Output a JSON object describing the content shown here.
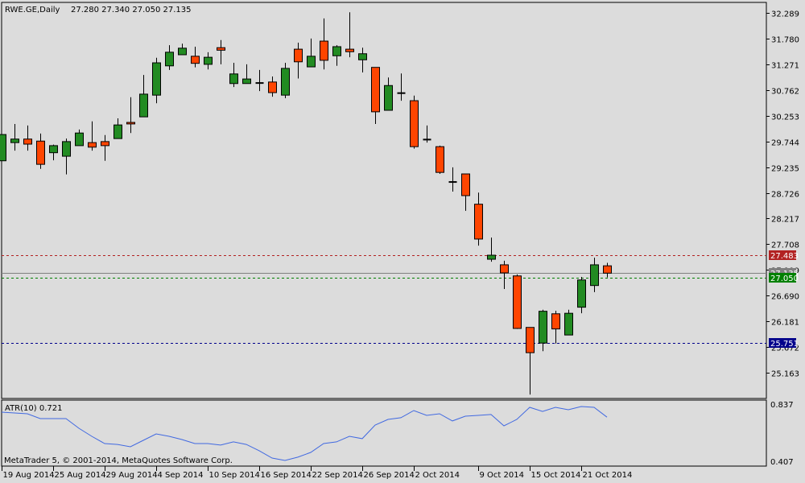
{
  "header": {
    "symbol_info": "RWE.GE,Daily",
    "ohlc": "27.280 27.340 27.050 27.135"
  },
  "indicator": {
    "label": "ATR(10) 0.721",
    "axis_top": "0.837",
    "axis_bottom": "0.407"
  },
  "copyright": "MetaTrader 5, © 2001-2014, MetaQuotes Software Corp.",
  "colors": {
    "background": "#dcdcdc",
    "bull": "#228b22",
    "bear": "#ff4500",
    "atr_line": "#4169e1",
    "ask_line": "#b22222",
    "bid_line": "#008000",
    "level_line": "#00008b",
    "last_line": "#808080"
  },
  "price_levels": [
    {
      "name": "ask-line",
      "value": "27.483",
      "color": "#b22222",
      "style": "dashed"
    },
    {
      "name": "last-price-line",
      "value": "27.135",
      "color": "#808080",
      "style": "solid"
    },
    {
      "name": "bid-line",
      "value": "27.050",
      "color": "#008000",
      "style": "dashed"
    },
    {
      "name": "horizontal-level-line",
      "value": "25.751",
      "color": "#00008b",
      "style": "dashed"
    }
  ],
  "chart_data": {
    "type": "candlestick",
    "price_axis_ticks": [
      "32.289",
      "31.780",
      "31.271",
      "30.762",
      "30.253",
      "29.744",
      "29.235",
      "28.726",
      "28.217",
      "27.708",
      "27.199",
      "26.690",
      "26.181",
      "25.672",
      "25.163"
    ],
    "date_labels": [
      {
        "index": 0,
        "label": "19 Aug 2014"
      },
      {
        "index": 4,
        "label": "25 Aug 2014"
      },
      {
        "index": 8,
        "label": "29 Aug 2014"
      },
      {
        "index": 12,
        "label": "4 Sep 2014"
      },
      {
        "index": 16,
        "label": "10 Sep 2014"
      },
      {
        "index": 20,
        "label": "16 Sep 2014"
      },
      {
        "index": 24,
        "label": "22 Sep 2014"
      },
      {
        "index": 28,
        "label": "26 Sep 2014"
      },
      {
        "index": 32,
        "label": "2 Oct 2014"
      },
      {
        "index": 37,
        "label": "9 Oct 2014"
      },
      {
        "index": 41,
        "label": "15 Oct 2014"
      },
      {
        "index": 45,
        "label": "21 Oct 2014"
      }
    ],
    "ohlc": [
      [
        29.36,
        29.88,
        29.36,
        29.88
      ],
      [
        29.72,
        30.09,
        29.56,
        29.79
      ],
      [
        29.79,
        30.06,
        29.56,
        29.69
      ],
      [
        29.75,
        29.9,
        29.2,
        29.29
      ],
      [
        29.52,
        29.68,
        29.37,
        29.66
      ],
      [
        29.45,
        29.8,
        29.09,
        29.74
      ],
      [
        29.66,
        29.98,
        29.66,
        29.91
      ],
      [
        29.72,
        30.14,
        29.56,
        29.63
      ],
      [
        29.74,
        29.87,
        29.36,
        29.66
      ],
      [
        29.8,
        30.2,
        29.8,
        30.07
      ],
      [
        30.12,
        30.62,
        29.91,
        30.09
      ],
      [
        30.23,
        31.06,
        30.23,
        30.68
      ],
      [
        30.66,
        31.4,
        30.5,
        31.3
      ],
      [
        31.24,
        31.65,
        31.16,
        31.51
      ],
      [
        31.46,
        31.68,
        31.46,
        31.59
      ],
      [
        31.43,
        31.62,
        31.21,
        31.29
      ],
      [
        31.27,
        31.51,
        31.17,
        31.41
      ],
      [
        31.6,
        31.75,
        31.27,
        31.55
      ],
      [
        30.89,
        31.3,
        30.82,
        31.08
      ],
      [
        30.89,
        31.27,
        30.89,
        30.98
      ],
      [
        30.9,
        31.16,
        30.74,
        30.9
      ],
      [
        30.92,
        31.03,
        30.63,
        30.71
      ],
      [
        30.66,
        31.3,
        30.6,
        31.19
      ],
      [
        31.57,
        31.7,
        30.99,
        31.32
      ],
      [
        31.22,
        31.78,
        31.22,
        31.43
      ],
      [
        31.73,
        32.18,
        31.17,
        31.35
      ],
      [
        31.44,
        31.65,
        31.24,
        31.62
      ],
      [
        31.57,
        32.3,
        31.41,
        31.52
      ],
      [
        31.36,
        31.6,
        31.11,
        31.48
      ],
      [
        31.21,
        31.21,
        30.09,
        30.33
      ],
      [
        30.36,
        31.01,
        30.36,
        30.85
      ],
      [
        30.7,
        31.09,
        30.55,
        30.7
      ],
      [
        30.55,
        30.65,
        29.6,
        29.64
      ],
      [
        29.78,
        30.06,
        29.72,
        29.78
      ],
      [
        29.64,
        29.66,
        29.1,
        29.13
      ],
      [
        28.94,
        29.23,
        28.75,
        28.94
      ],
      [
        29.1,
        29.1,
        28.37,
        28.67
      ],
      [
        28.5,
        28.73,
        27.68,
        27.81
      ],
      [
        27.41,
        27.84,
        27.36,
        27.49
      ],
      [
        27.3,
        27.38,
        26.82,
        27.14
      ],
      [
        27.08,
        27.11,
        26.03,
        26.04
      ],
      [
        26.06,
        26.06,
        24.73,
        25.56
      ],
      [
        25.75,
        26.41,
        25.59,
        26.38
      ],
      [
        26.33,
        26.39,
        25.74,
        26.03
      ],
      [
        25.91,
        26.41,
        25.91,
        26.34
      ],
      [
        26.46,
        27.06,
        26.34,
        27.0
      ],
      [
        26.89,
        27.44,
        26.76,
        27.3
      ],
      [
        27.28,
        27.34,
        27.05,
        27.135
      ]
    ],
    "atr": [
      0.757,
      0.751,
      0.745,
      0.711,
      0.711,
      0.711,
      0.642,
      0.585,
      0.533,
      0.527,
      0.51,
      0.556,
      0.602,
      0.585,
      0.562,
      0.533,
      0.533,
      0.522,
      0.545,
      0.527,
      0.482,
      0.43,
      0.413,
      0.436,
      0.47,
      0.533,
      0.545,
      0.585,
      0.568,
      0.665,
      0.705,
      0.717,
      0.768,
      0.734,
      0.745,
      0.694,
      0.728,
      0.734,
      0.74,
      0.659,
      0.705,
      0.791,
      0.762,
      0.791,
      0.774,
      0.797,
      0.791,
      0.721
    ],
    "price_range": [
      25.163,
      32.289
    ],
    "atr_range": [
      0.407,
      0.837
    ],
    "grid": false
  }
}
